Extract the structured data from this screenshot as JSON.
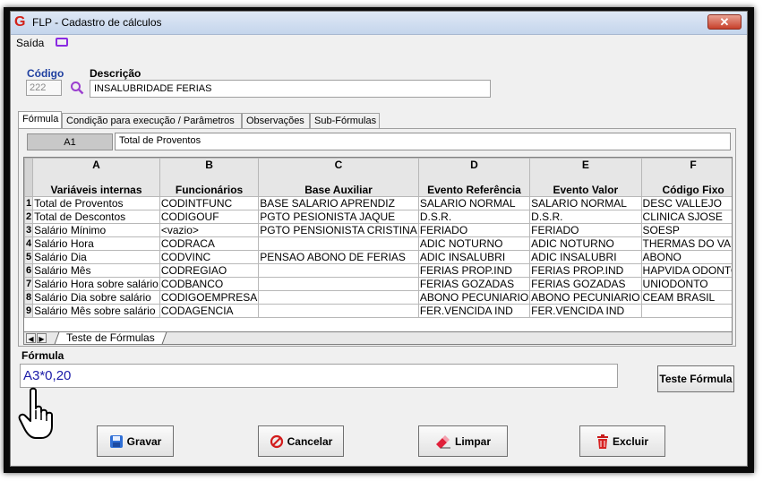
{
  "window": {
    "title": "FLP - Cadastro de cálculos",
    "close": "✕"
  },
  "menu": {
    "saida": "Saída"
  },
  "form": {
    "codigo_label": "Código",
    "codigo_value": "222",
    "descricao_label": "Descrição",
    "descricao_value": "INSALUBRIDADE FERIAS"
  },
  "tabs": [
    "Fórmula",
    "Condição para execução / Parâmetros",
    "Observações",
    "Sub-Fórmulas"
  ],
  "cell_ref": "A1",
  "cell_content": "Total de Proventos",
  "grid": {
    "col_letters": [
      "A",
      "B",
      "C",
      "D",
      "E",
      "F"
    ],
    "col_titles": [
      "Variáveis internas",
      "Funcionários",
      "Base Auxiliar",
      "Evento Referência",
      "Evento Valor",
      "Código Fixo"
    ],
    "rows": [
      [
        "1",
        "Total de Proventos",
        "CODINTFUNC",
        "BASE SALARIO APRENDIZ",
        "SALARIO NORMAL",
        "SALARIO NORMAL",
        "DESC VALLEJO"
      ],
      [
        "2",
        "Total de Descontos",
        "CODIGOUF",
        "PGTO PESIONISTA JAQUE",
        "D.S.R.",
        "D.S.R.",
        "CLINICA SJOSE"
      ],
      [
        "3",
        "Salário Mínimo",
        "<vazio>",
        "PGTO PENSIONISTA CRISTINA",
        "FERIADO",
        "FERIADO",
        "SOESP"
      ],
      [
        "4",
        "Salário Hora",
        "CODRACA",
        "",
        "ADIC NOTURNO",
        "ADIC NOTURNO",
        "THERMAS DO VALE"
      ],
      [
        "5",
        "Salário Dia",
        "CODVINC",
        "PENSAO ABONO DE FERIAS",
        "ADIC INSALUBRI",
        "ADIC INSALUBRI",
        "ABONO"
      ],
      [
        "6",
        "Salário Mês",
        "CODREGIAO",
        "",
        "FERIAS PROP.IND",
        "FERIAS PROP.IND",
        "HAPVIDA ODONTO"
      ],
      [
        "7",
        "Salário Hora sobre salário",
        "CODBANCO",
        "",
        "FERIAS GOZADAS",
        "FERIAS GOZADAS",
        "UNIODONTO"
      ],
      [
        "8",
        "Salário Dia sobre salário",
        "CODIGOEMPRESA",
        "",
        "ABONO PECUNIARIO",
        "ABONO PECUNIARIO",
        "CEAM BRASIL"
      ],
      [
        "9",
        "Salário Mês sobre salário",
        "CODAGENCIA",
        "",
        "FER.VENCIDA IND",
        "FER.VENCIDA IND",
        ""
      ]
    ]
  },
  "sheet_tab": "Teste de Fórmulas",
  "formula": {
    "label": "Fórmula",
    "value": "A3*0,20",
    "test_button": "Teste Fórmula"
  },
  "buttons": {
    "gravar": "Gravar",
    "cancelar": "Cancelar",
    "limpar": "Limpar",
    "excluir": "Excluir"
  },
  "colors": {
    "accent_blue": "#1f3fa0",
    "formula_text": "#1a1aa8",
    "logo_red": "#d2221a"
  },
  "icons": [
    "app-logo-icon",
    "monitor-icon",
    "search-icon",
    "save-icon",
    "cancel-icon",
    "eraser-icon",
    "trash-icon",
    "hand-pointer-icon"
  ]
}
